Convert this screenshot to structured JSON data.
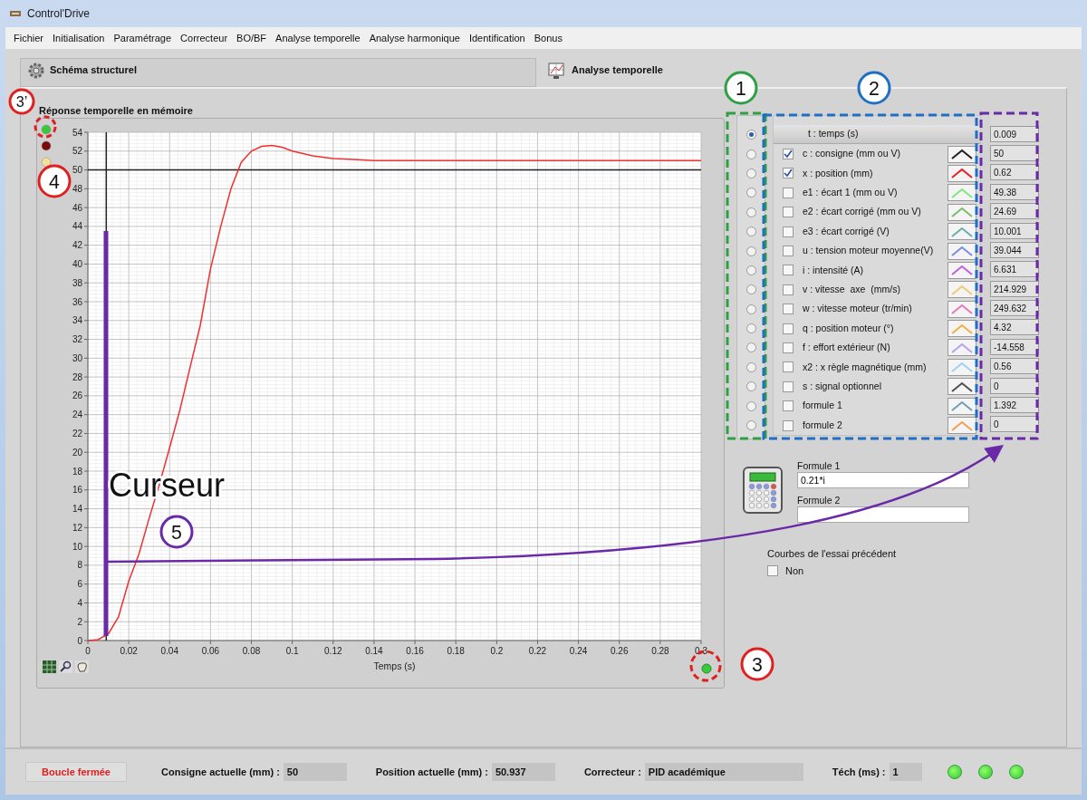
{
  "window": {
    "title": "Control'Drive"
  },
  "menu": [
    "Fichier",
    "Initialisation",
    "Paramétrage",
    "Correcteur",
    "BO/BF",
    "Analyse temporelle",
    "Analyse harmonique",
    "Identification",
    "Bonus"
  ],
  "tabs": [
    {
      "label": "Schéma structurel",
      "selected": false
    },
    {
      "label": "Analyse temporelle",
      "selected": true
    }
  ],
  "graph": {
    "title": "Réponse temporelle en mémoire",
    "leds": [
      {
        "color": "#3cc83c"
      },
      {
        "color": "#7a0a0a"
      },
      {
        "color": "#f3e09a"
      }
    ],
    "chart_data": {
      "type": "line",
      "xlabel": "Temps (s)",
      "x": [
        0,
        0.005,
        0.01,
        0.015,
        0.02,
        0.025,
        0.03,
        0.035,
        0.04,
        0.045,
        0.05,
        0.055,
        0.06,
        0.065,
        0.07,
        0.075,
        0.08,
        0.085,
        0.09,
        0.095,
        0.1,
        0.11,
        0.12,
        0.13,
        0.14,
        0.16,
        0.18,
        0.2,
        0.22,
        0.24,
        0.26,
        0.28,
        0.3
      ],
      "series": [
        {
          "color": "#202020",
          "values": [
            50,
            50,
            50,
            50,
            50,
            50,
            50,
            50,
            50,
            50,
            50,
            50,
            50,
            50,
            50,
            50,
            50,
            50,
            50,
            50,
            50,
            50,
            50,
            50,
            50,
            50,
            50,
            50,
            50,
            50,
            50,
            50,
            50
          ]
        },
        {
          "color": "#f03030",
          "values": [
            0,
            0.1,
            0.7,
            2.5,
            6.3,
            9.2,
            13,
            16.6,
            20.5,
            24.5,
            29,
            33.5,
            39.5,
            44,
            48,
            50.8,
            52,
            52.5,
            52.6,
            52.4,
            52,
            51.5,
            51.2,
            51.1,
            51,
            51,
            51,
            51,
            51,
            51,
            51,
            51,
            51
          ]
        }
      ],
      "xlim": [
        0,
        0.3
      ],
      "ylim": [
        0,
        54
      ],
      "xticks": [
        0,
        0.02,
        0.04,
        0.06,
        0.08,
        0.1,
        0.12,
        0.14,
        0.16,
        0.18,
        0.2,
        0.22,
        0.24,
        0.26,
        0.28,
        0.3
      ],
      "yticks": [
        0,
        2,
        4,
        6,
        8,
        10,
        12,
        14,
        16,
        18,
        20,
        22,
        24,
        26,
        28,
        30,
        32,
        34,
        36,
        38,
        40,
        42,
        44,
        46,
        48,
        50,
        52,
        54
      ],
      "grid": true,
      "ref_lines": [
        {
          "axis": "x",
          "value": 0.009,
          "color": "#222222"
        }
      ]
    }
  },
  "channels": {
    "header": {
      "label": "t : temps (s)",
      "selected": true,
      "value": "0.009"
    },
    "items": [
      {
        "label": "c : consigne (mm ou V)",
        "checked": true,
        "selected": false,
        "color": "#202020",
        "value": "50"
      },
      {
        "label": "x : position (mm)",
        "checked": true,
        "selected": false,
        "color": "#e82020",
        "value": "0.62"
      },
      {
        "label": "e1 : écart 1 (mm ou V)",
        "checked": false,
        "selected": false,
        "color": "#7fe87f",
        "value": "49.38"
      },
      {
        "label": "e2 : écart corrigé (mm ou V)",
        "checked": false,
        "selected": false,
        "color": "#7cbc6a",
        "value": "24.69"
      },
      {
        "label": "e3 : écart corrigé (V)",
        "checked": false,
        "selected": false,
        "color": "#6ab0a8",
        "value": "10.001"
      },
      {
        "label": "u : tension moteur moyenne(V)",
        "checked": false,
        "selected": false,
        "color": "#7a8ce8",
        "value": "39.044"
      },
      {
        "label": "i : intensité (A)",
        "checked": false,
        "selected": false,
        "color": "#c060e0",
        "value": "6.631"
      },
      {
        "label": "v : vitesse  axe  (mm/s)",
        "checked": false,
        "selected": false,
        "color": "#f0c878",
        "value": "214.929"
      },
      {
        "label": "w : vitesse moteur (tr/min)",
        "checked": false,
        "selected": false,
        "color": "#e878b8",
        "value": "249.632"
      },
      {
        "label": "q : position moteur (°)",
        "checked": false,
        "selected": false,
        "color": "#f0b040",
        "value": "4.32"
      },
      {
        "label": "f : effort extérieur (N)",
        "checked": false,
        "selected": false,
        "color": "#b8a0f0",
        "value": "-14.558"
      },
      {
        "label": "x2 : x règle magnétique (mm)",
        "checked": false,
        "selected": false,
        "color": "#a0d0f0",
        "value": "0.56"
      },
      {
        "label": "s : signal optionnel",
        "checked": false,
        "selected": false,
        "color": "#505050",
        "value": "0"
      },
      {
        "label": "formule 1",
        "checked": false,
        "selected": false,
        "color": "#70a0b0",
        "value": "1.392"
      },
      {
        "label": "formule 2",
        "checked": false,
        "selected": false,
        "color": "#f0a050",
        "value": "0"
      }
    ]
  },
  "formulas": [
    {
      "label": "Formule 1",
      "value": "0.21*i"
    },
    {
      "label": "Formule 2"
    }
  ],
  "previous_curves": {
    "label": "Courbes de l'essai précédent",
    "option": "Non",
    "checked": false
  },
  "status_bar": {
    "mode": "Boucle fermée",
    "fields": [
      {
        "label": "Consigne actuelle (mm) :",
        "value": "50"
      },
      {
        "label": "Position actuelle (mm) :",
        "value": "50.937"
      },
      {
        "label": "Correcteur :",
        "value": "PID académique"
      },
      {
        "label": "Téch (ms) :",
        "value": "1"
      }
    ],
    "leds": [
      {
        "on": true
      },
      {
        "on": true
      },
      {
        "on": true
      }
    ]
  },
  "callouts": {
    "markers": [
      {
        "label": "3’",
        "color": "#e02020"
      },
      {
        "label": "1",
        "color": "#2ea043"
      },
      {
        "label": "2",
        "color": "#1f6fc4"
      },
      {
        "label": "4",
        "color": "#e02020"
      },
      {
        "label": "5",
        "color": "#6a2aa8"
      },
      {
        "label": "3",
        "color": "#e02020"
      }
    ],
    "caption": "Curseur"
  }
}
